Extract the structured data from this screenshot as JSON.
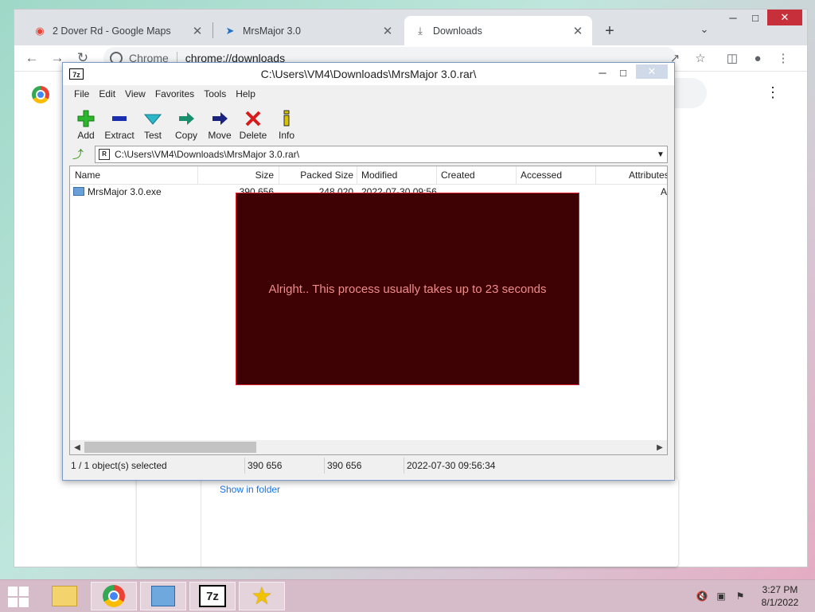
{
  "browser": {
    "tabs": [
      {
        "label": "2 Dover Rd - Google Maps",
        "icon": "map-pin-icon"
      },
      {
        "label": "MrsMajor 3.0",
        "icon": "bird-icon"
      },
      {
        "label": "Downloads",
        "icon": "download-icon"
      }
    ],
    "omnibox": {
      "site_label": "Chrome",
      "url": "chrome://downloads"
    },
    "downloads": {
      "show_in_folder": "Show in folder"
    }
  },
  "sevenzip": {
    "title": "C:\\Users\\VM4\\Downloads\\MrsMajor 3.0.rar\\",
    "app_icon_text": "7z",
    "menu": [
      "File",
      "Edit",
      "View",
      "Favorites",
      "Tools",
      "Help"
    ],
    "toolbar": [
      {
        "label": "Add",
        "icon": "plus-icon",
        "color": "#2db52d"
      },
      {
        "label": "Extract",
        "icon": "minus-icon",
        "color": "#1a2fb0"
      },
      {
        "label": "Test",
        "icon": "check-icon",
        "color": "#2bb6c9"
      },
      {
        "label": "Copy",
        "icon": "arrow-right-icon",
        "color": "#1a8f6e"
      },
      {
        "label": "Move",
        "icon": "arrow-right-icon",
        "color": "#1a237e"
      },
      {
        "label": "Delete",
        "icon": "x-icon",
        "color": "#d81b1b"
      },
      {
        "label": "Info",
        "icon": "info-icon",
        "color": "#d6c400"
      }
    ],
    "address": "C:\\Users\\VM4\\Downloads\\MrsMajor 3.0.rar\\",
    "columns": [
      "Name",
      "Size",
      "Packed Size",
      "Modified",
      "Created",
      "Accessed",
      "Attributes"
    ],
    "rows": [
      {
        "name": "MrsMajor 3.0.exe",
        "size": "390 656",
        "packed": "248 020",
        "modified": "2022-07-30 09:56",
        "attr": "A"
      }
    ],
    "status": {
      "selected": "1 / 1 object(s) selected",
      "size": "390 656",
      "packed": "390 656",
      "modified": "2022-07-30 09:56:34"
    }
  },
  "overlay": {
    "message": "Alright.. This process usually takes up to 23 seconds"
  },
  "taskbar": {
    "clock": {
      "time": "3:27 PM",
      "date": "8/1/2022"
    },
    "apps": [
      "file-explorer-icon",
      "chrome-icon",
      "control-panel-icon",
      "7zip-icon",
      "star-icon"
    ]
  },
  "colors": {
    "overlay_bg": "#3e0204",
    "overlay_text": "#f08b8b",
    "overlay_border": "#e0202c"
  }
}
